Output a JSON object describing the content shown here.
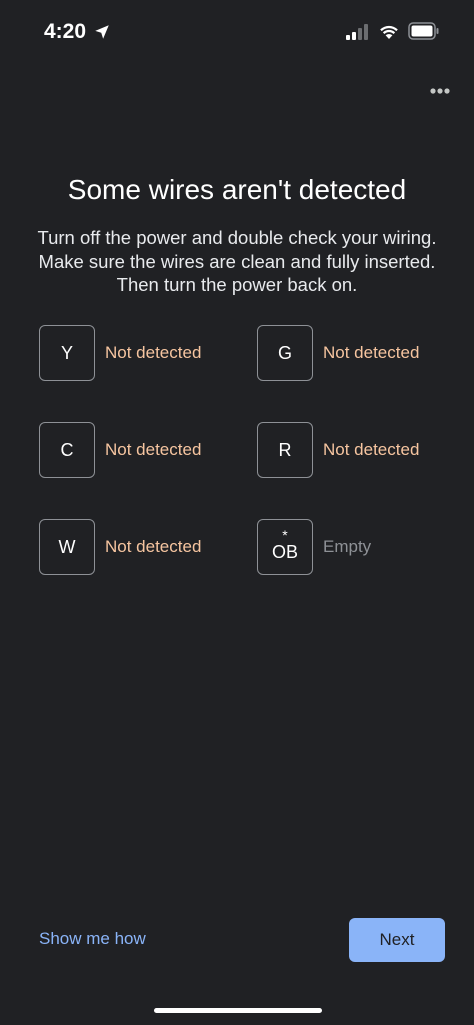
{
  "status_bar": {
    "time": "4:20",
    "icons": [
      "location-arrow-icon",
      "cellular-signal-icon",
      "wifi-icon",
      "battery-icon"
    ]
  },
  "header": {
    "menu_icon": "more-horizontal-icon"
  },
  "main": {
    "title": "Some wires aren't detected",
    "subtitle": "Turn off the power and double check your wiring. Make sure the wires are clean and fully inserted. Then turn the power back on.",
    "terminals": [
      {
        "label": "Y",
        "status": "Not detected"
      },
      {
        "label": "G",
        "status": "Not detected"
      },
      {
        "label": "C",
        "status": "Not detected"
      },
      {
        "label": "R",
        "status": "Not detected"
      },
      {
        "label": "W",
        "status": "Not detected"
      },
      {
        "label": "OB",
        "marker": "*",
        "status": "Empty"
      }
    ]
  },
  "footer": {
    "help_link": "Show me how",
    "next_label": "Next"
  },
  "colors": {
    "background": "#202124",
    "accent": "#8ab4f8",
    "warning_text": "#f6c5a0",
    "muted_text": "#8e9196"
  }
}
